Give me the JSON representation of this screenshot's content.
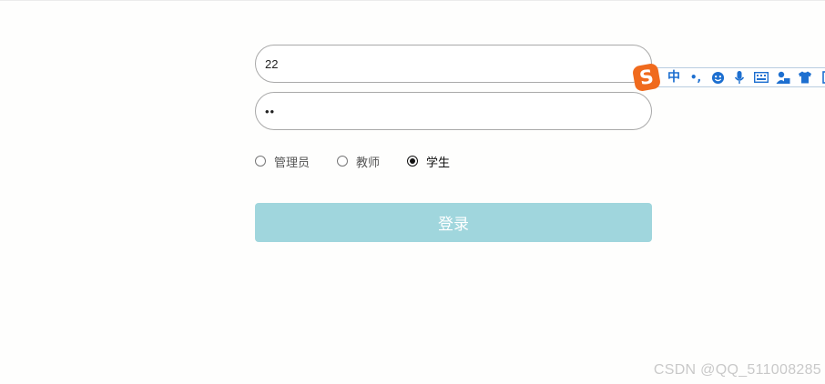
{
  "login_form": {
    "username_value": "22",
    "password_value": "22",
    "roles": [
      {
        "label": "管理员",
        "selected": false
      },
      {
        "label": "教师",
        "selected": false
      },
      {
        "label": "学生",
        "selected": true
      }
    ],
    "login_label": "登录",
    "button_color": "#a0d6dd"
  },
  "ime_toolbar": {
    "logo": "S",
    "mode_label": "中",
    "punct_label": "•,",
    "icons": [
      "emoji-icon",
      "microphone-icon",
      "keyboard-icon",
      "user-icon",
      "skin-icon",
      "more-icon"
    ],
    "accent_color": "#f06a1d"
  },
  "watermark": {
    "text": "CSDN @QQ_511008285"
  }
}
